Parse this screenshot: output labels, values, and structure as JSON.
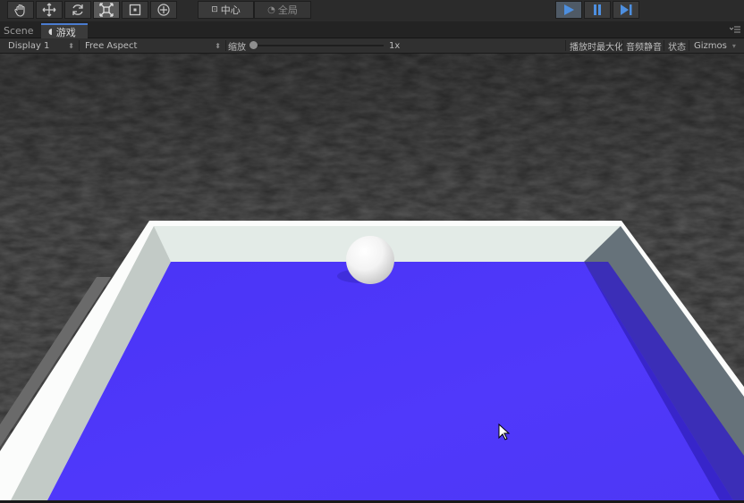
{
  "toolbar": {
    "tools": [
      "hand-tool",
      "move-tool",
      "rotate-tool",
      "scale-tool",
      "rect-tool",
      "transform-tool"
    ],
    "active_tool": "scale-tool",
    "pivot_label": "中心",
    "global_label": "全局",
    "play_state": "playing"
  },
  "tabs": {
    "scene_label": "Scene",
    "game_label": "游戏"
  },
  "game_view": {
    "display_label": "Display 1",
    "aspect_label": "Free Aspect",
    "scale_label": "缩放",
    "scale_value": "1x",
    "maximize_on_play": "播放时最大化",
    "mute_audio": "音频静音",
    "stats": "状态",
    "gizmos": "Gizmos"
  },
  "colors": {
    "floor": "#4f38fb",
    "wall_light": "#e4ece8",
    "ground": "#5a5a5a",
    "accent": "#4a7bd0"
  }
}
